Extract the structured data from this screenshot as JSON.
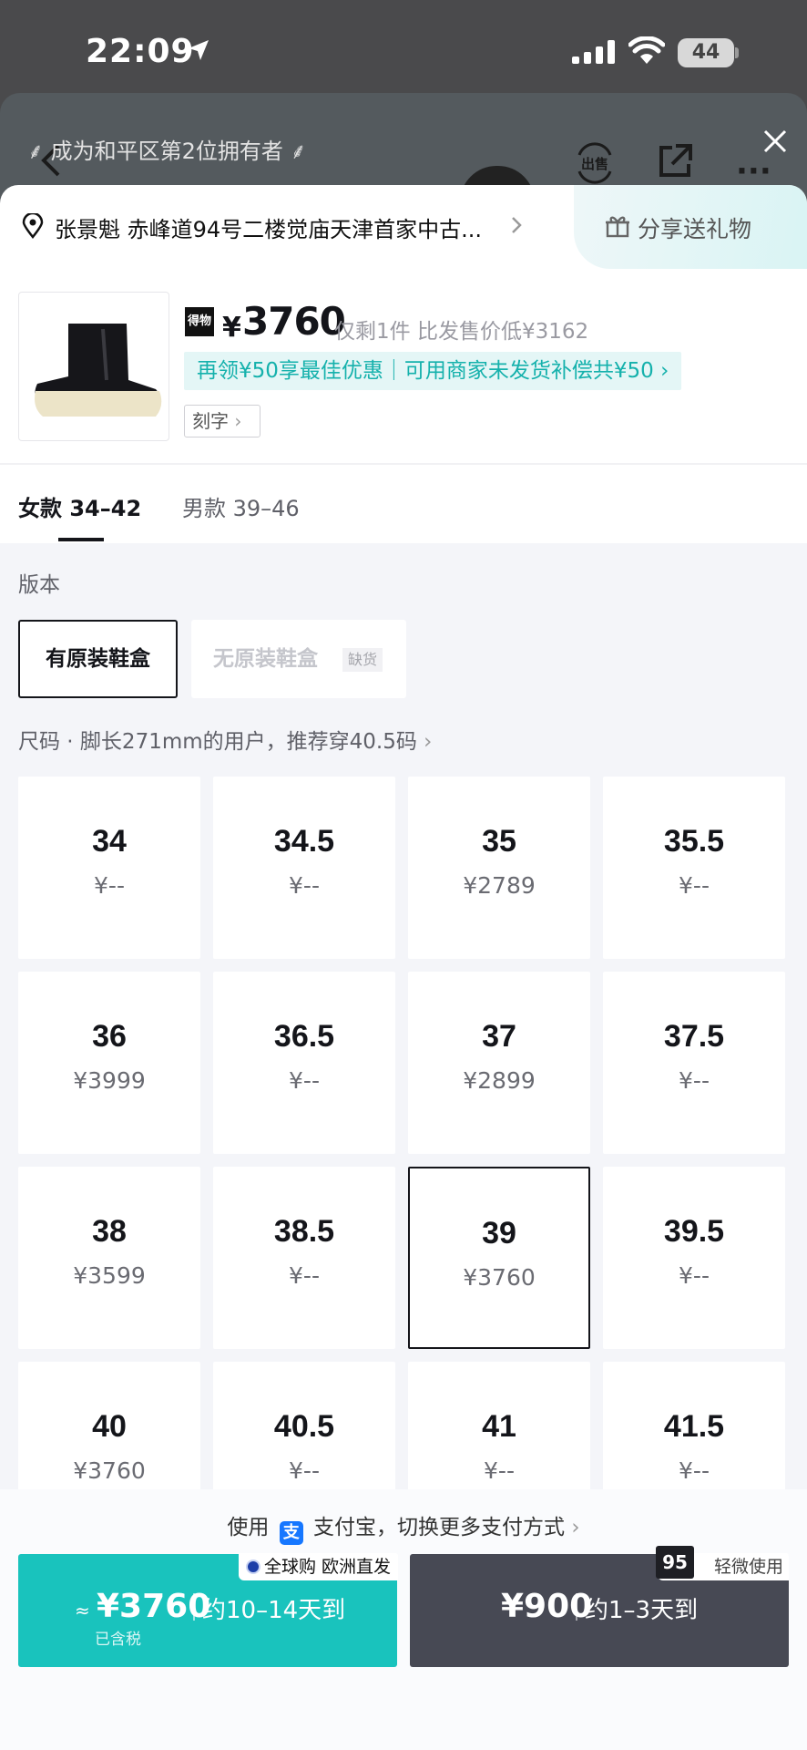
{
  "status": {
    "time": "22:09",
    "battery": "44"
  },
  "header": {
    "owner_banner": "成为和平区第2位拥有者",
    "sell_label": "出售"
  },
  "address": {
    "text": "张景魁 赤峰道94号二楼觉庙天津首家中古...",
    "gift_label": "分享送礼物"
  },
  "product": {
    "brand_badge": "得物",
    "currency": "¥",
    "price": "3760",
    "note": "仅剩1件 比发售价低¥3162",
    "promo": "再领¥50享最佳优惠｜可用商家未发货补偿共¥50",
    "engrave_label": "刻字"
  },
  "tabs": [
    {
      "label": "女款 34–42",
      "active": true
    },
    {
      "label": "男款 39–46",
      "active": false
    }
  ],
  "version": {
    "label": "版本",
    "options": [
      {
        "label": "有原装鞋盒",
        "selected": true
      },
      {
        "label": "无原装鞋盒",
        "badge": "缺货",
        "disabled": true
      }
    ]
  },
  "size_hint": "尺码 · 脚长271mm的用户，推荐穿40.5码",
  "sizes": [
    {
      "size": "34",
      "price": "¥--"
    },
    {
      "size": "34.5",
      "price": "¥--"
    },
    {
      "size": "35",
      "price": "¥2789"
    },
    {
      "size": "35.5",
      "price": "¥--"
    },
    {
      "size": "36",
      "price": "¥3999"
    },
    {
      "size": "36.5",
      "price": "¥--"
    },
    {
      "size": "37",
      "price": "¥2899"
    },
    {
      "size": "37.5",
      "price": "¥--"
    },
    {
      "size": "38",
      "price": "¥3599"
    },
    {
      "size": "38.5",
      "price": "¥--"
    },
    {
      "size": "39",
      "price": "¥3760",
      "selected": true
    },
    {
      "size": "39.5",
      "price": "¥--"
    },
    {
      "size": "40",
      "price": "¥3760"
    },
    {
      "size": "40.5",
      "price": "¥--"
    },
    {
      "size": "41",
      "price": "¥--"
    },
    {
      "size": "41.5",
      "price": "¥--"
    }
  ],
  "payment": {
    "prefix": "使用",
    "alipay_glyph": "支",
    "suffix": "支付宝，切换更多支付方式"
  },
  "buy_new": {
    "tag": "全球购 欧洲直发",
    "approx": "≈",
    "price": "¥3760",
    "eta": "约10–14天到",
    "tax": "已含税"
  },
  "buy_used": {
    "badge": "95",
    "tag": "轻微使用",
    "price": "¥900",
    "eta": "约1–3天到"
  },
  "colors": {
    "accent": "#19c3bd",
    "dark_button": "#474954"
  }
}
